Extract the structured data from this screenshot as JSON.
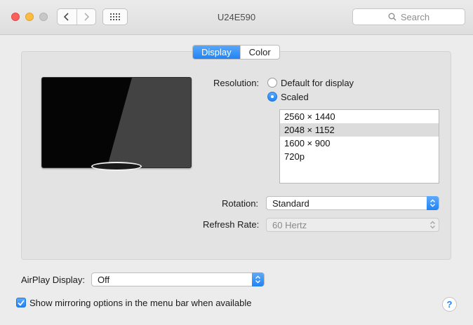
{
  "window": {
    "title": "U24E590",
    "search_placeholder": "Search"
  },
  "tabs": [
    {
      "label": "Display",
      "active": true
    },
    {
      "label": "Color",
      "active": false
    }
  ],
  "resolution": {
    "label": "Resolution:",
    "options": [
      {
        "label": "Default for display",
        "selected": false
      },
      {
        "label": "Scaled",
        "selected": true
      }
    ],
    "scaled_list": [
      "2560 × 1440",
      "2048 × 1152",
      "1600 × 900",
      "720p"
    ],
    "selected_index": 1
  },
  "rotation": {
    "label": "Rotation:",
    "value": "Standard"
  },
  "refresh_rate": {
    "label": "Refresh Rate:",
    "value": "60 Hertz"
  },
  "airplay": {
    "label": "AirPlay Display:",
    "value": "Off"
  },
  "mirroring_checkbox": {
    "label": "Show mirroring options in the menu bar when available",
    "checked": true
  },
  "help_button": {
    "label": "?"
  },
  "colors": {
    "accent": "#1f83f5",
    "close": "#fc605c",
    "minimize": "#fdbc40"
  }
}
